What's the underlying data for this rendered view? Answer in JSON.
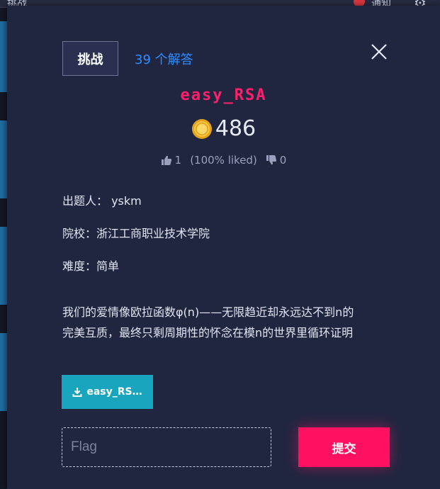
{
  "background": {
    "page_title": "挑战",
    "notification_label": "通知"
  },
  "modal": {
    "tabs": {
      "challenge": "挑战",
      "solves": "39 个解答"
    },
    "challenge_name": "easy_RSA",
    "points": "486",
    "likes": {
      "up_count": "1",
      "liked_percent": "(100% liked)",
      "down_count": "0"
    },
    "author": "出题人： yskm",
    "school": "院校：浙江工商职业技术学院",
    "difficulty": "难度：简单",
    "description_line1": "我们的爱情像欧拉函数φ(n)——无限趋近却永远达不到n的",
    "description_line2": "完美互质，最终只剩周期性的怀念在模n的世界里循环证明",
    "download_label": "easy_RS…",
    "flag_placeholder": "Flag",
    "flag_value": "",
    "submit_label": "提交"
  },
  "colors": {
    "accent_pink": "#ff1162",
    "link_blue": "#2f8dff",
    "download_teal": "#19a5bd",
    "modal_bg": "#212640"
  }
}
